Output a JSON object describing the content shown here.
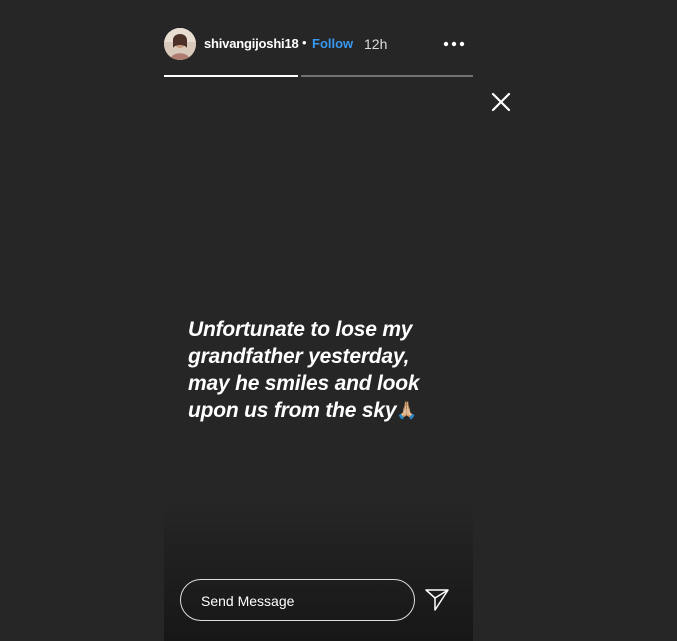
{
  "header": {
    "username": "shivangijoshi18",
    "separator": "•",
    "follow_label": "Follow",
    "time": "12h",
    "avatar_icon": "profile-photo",
    "more_icon": "more-options-icon"
  },
  "progress": {
    "segments": [
      {
        "filled": 1.0
      },
      {
        "filled": 0.0
      }
    ]
  },
  "close_icon": "close-icon",
  "caption": {
    "lines": [
      "Unfortunate to lose my",
      "grandfather yesterday,",
      "may he smiles and look",
      "upon us from the sky"
    ],
    "emoji": "🙏🏼"
  },
  "message": {
    "placeholder": "Send Message"
  },
  "send_icon": "send-icon",
  "colors": {
    "background": "#262626",
    "follow": "#3897f0",
    "text": "#ffffff"
  }
}
